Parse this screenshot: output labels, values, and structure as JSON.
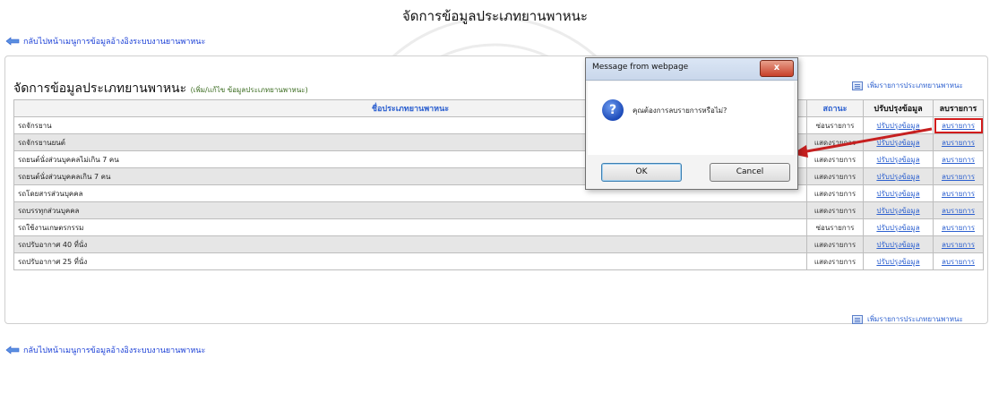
{
  "page": {
    "title": "จัดการข้อมูลประเภทยานพาหนะ"
  },
  "nav": {
    "back_link": "กลับไปหน้าเมนูการข้อมูลอ้างอิงระบบงานยานพาหนะ",
    "back_link_bottom": "กลับไปหน้าเมนูการข้อมูลอ้างอิงระบบงานยานพาหนะ"
  },
  "section": {
    "title": "จัดการข้อมูลประเภทยานพาหนะ",
    "subtitle": "(เพิ่ม/แก้ไข ข้อมูลประเภทยานพาหนะ)",
    "add_link": "เพิ่มรายการประเภทยานพาหนะ",
    "add_link_bottom": "เพิ่มรายการประเภทยานพาหนะ"
  },
  "table": {
    "headers": {
      "name": "ชื่อประเภทยานพาหนะ",
      "status": "สถานะ",
      "edit": "ปรับปรุงข้อมูล",
      "delete": "ลบรายการ"
    },
    "rows": [
      {
        "name": "รถจักรยาน",
        "status": "ซ่อนรายการ",
        "edit": "ปรับปรุงข้อมูล",
        "delete": "ลบรายการ"
      },
      {
        "name": "รถจักรยานยนต์",
        "status": "แสดงรายการ",
        "edit": "ปรับปรุงข้อมูล",
        "delete": "ลบรายการ"
      },
      {
        "name": "รถยนต์นั่งส่วนบุคคลไม่เกิน 7 คน",
        "status": "แสดงรายการ",
        "edit": "ปรับปรุงข้อมูล",
        "delete": "ลบรายการ"
      },
      {
        "name": "รถยนต์นั่งส่วนบุคคลเกิน 7 คน",
        "status": "แสดงรายการ",
        "edit": "ปรับปรุงข้อมูล",
        "delete": "ลบรายการ"
      },
      {
        "name": "รถโดยสารส่วนบุคคล",
        "status": "แสดงรายการ",
        "edit": "ปรับปรุงข้อมูล",
        "delete": "ลบรายการ"
      },
      {
        "name": "รถบรรทุกส่วนบุคคล",
        "status": "แสดงรายการ",
        "edit": "ปรับปรุงข้อมูล",
        "delete": "ลบรายการ"
      },
      {
        "name": "รถใช้งานเกษตรกรรม",
        "status": "ซ่อนรายการ",
        "edit": "ปรับปรุงข้อมูล",
        "delete": "ลบรายการ"
      },
      {
        "name": "รถปรับอากาศ 40 ที่นั่ง",
        "status": "แสดงรายการ",
        "edit": "ปรับปรุงข้อมูล",
        "delete": "ลบรายการ"
      },
      {
        "name": "รถปรับอากาศ 25 ที่นั่ง",
        "status": "แสดงรายการ",
        "edit": "ปรับปรุงข้อมูล",
        "delete": "ลบรายการ"
      }
    ]
  },
  "dialog": {
    "title": "Message from webpage",
    "message": "คุณต้องการลบรายการหรือไม่?",
    "ok": "OK",
    "cancel": "Cancel",
    "close": "x"
  },
  "colors": {
    "link": "#2b5fcf",
    "highlight": "#d21c1c",
    "row_alt": "#e6e6e6"
  }
}
